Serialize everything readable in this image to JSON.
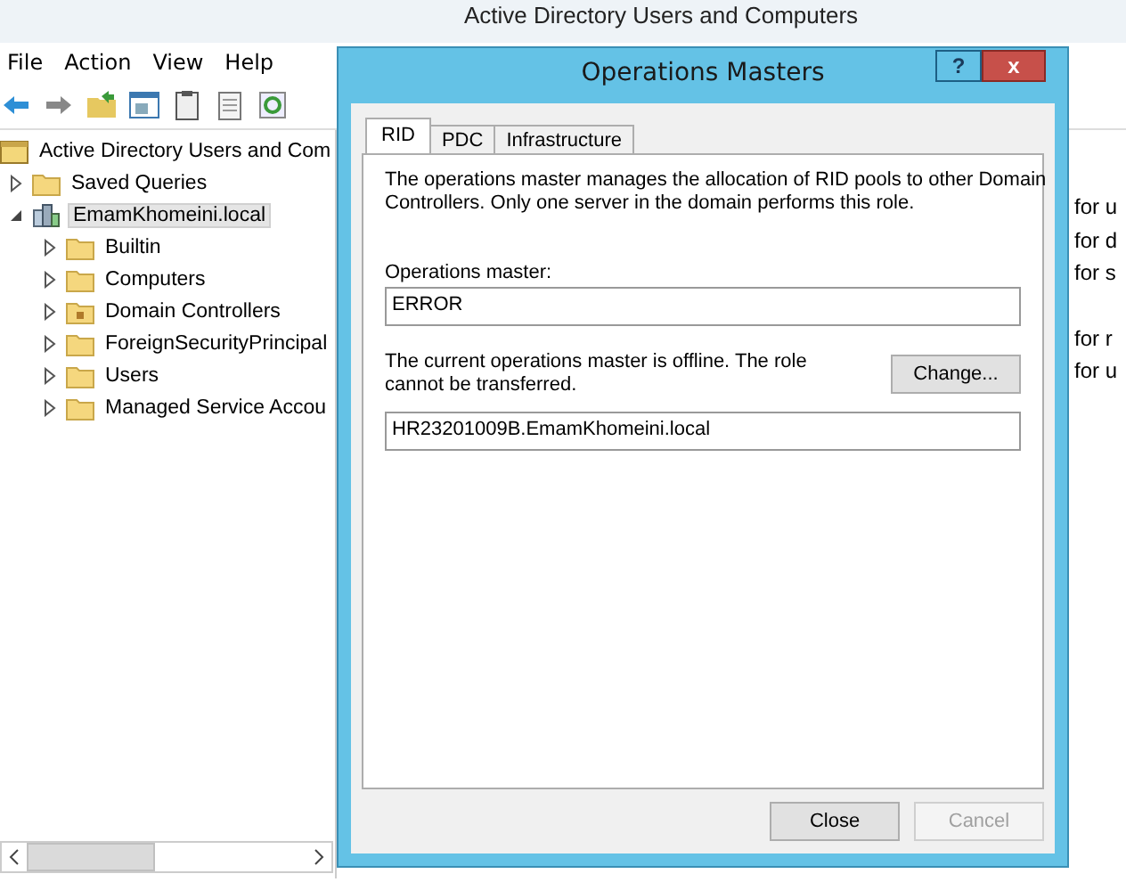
{
  "main_window": {
    "title": "Active Directory Users and Computers"
  },
  "menu": [
    "File",
    "Action",
    "View",
    "Help"
  ],
  "tree": [
    {
      "label": "Active Directory Users and Com",
      "kind": "root",
      "selected": false,
      "children": [
        {
          "label": "Saved Queries",
          "kind": "folder",
          "expanded": false,
          "selected": false
        },
        {
          "label": "EmamKhomeini.local",
          "kind": "domain",
          "expanded": true,
          "selected": true,
          "children": [
            {
              "label": "Builtin",
              "kind": "folder",
              "expanded": false,
              "selected": false
            },
            {
              "label": "Computers",
              "kind": "folder",
              "expanded": false,
              "selected": false
            },
            {
              "label": "Domain Controllers",
              "kind": "ou",
              "expanded": false,
              "selected": false
            },
            {
              "label": "ForeignSecurityPrincipal",
              "kind": "folder",
              "expanded": false,
              "selected": false
            },
            {
              "label": "Users",
              "kind": "folder",
              "expanded": false,
              "selected": false
            },
            {
              "label": "Managed Service Accou",
              "kind": "folder",
              "expanded": false,
              "selected": false
            }
          ]
        }
      ]
    }
  ],
  "list_fragments": [
    "for u",
    "for d",
    "for s",
    "for r",
    "for u"
  ],
  "dialog": {
    "title": "Operations Masters",
    "help": "?",
    "close": "x",
    "tabs": [
      {
        "label": "RID",
        "selected": true
      },
      {
        "label": "PDC",
        "selected": false
      },
      {
        "label": "Infrastructure",
        "selected": false
      }
    ],
    "description": "The operations master manages the allocation of RID pools to other Domain Controllers. Only one server in the domain performs this role.",
    "master_label": "Operations master:",
    "master_value": "ERROR",
    "status_text": "The current operations master is offline. The role cannot be transferred.",
    "change_button": "Change...",
    "target_value": "HR23201009B.EmamKhomeini.local",
    "buttons": [
      {
        "label": "Close",
        "disabled": false
      },
      {
        "label": "Cancel",
        "disabled": true
      }
    ]
  }
}
